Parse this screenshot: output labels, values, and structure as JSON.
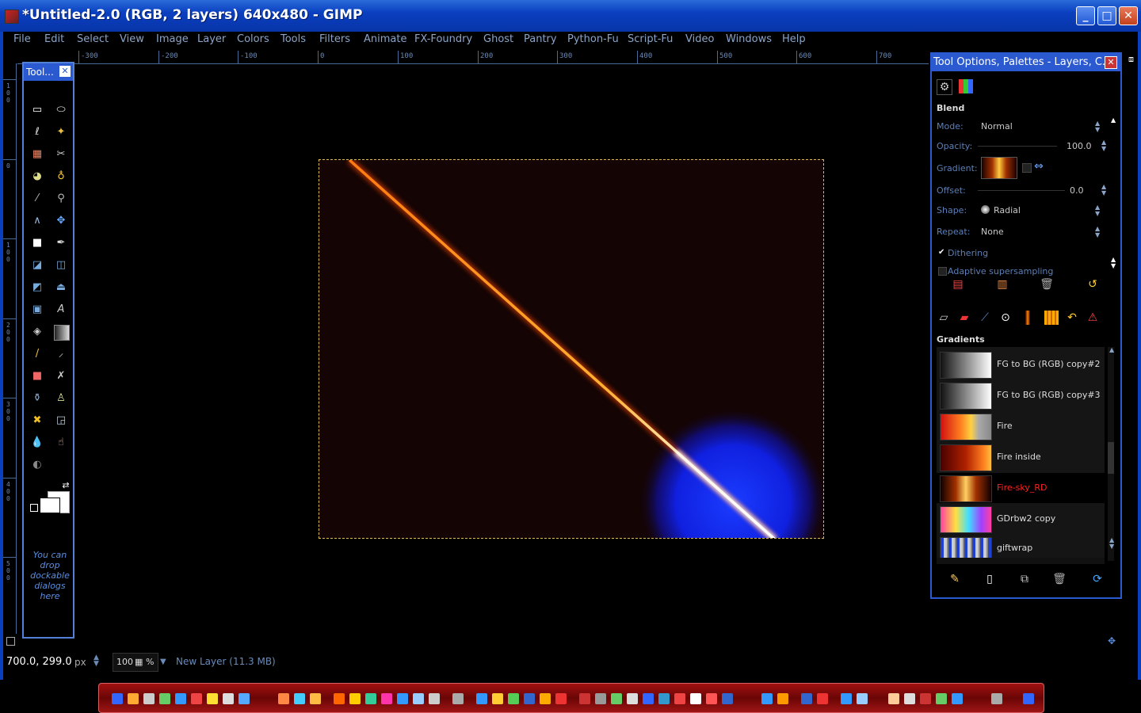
{
  "window": {
    "title": "*Untitled-2.0 (RGB, 2 layers) 640x480 - GIMP",
    "minimize": "_",
    "maximize": "□",
    "close": "✕"
  },
  "menu": [
    "File",
    "Edit",
    "Select",
    "View",
    "Image",
    "Layer",
    "Colors",
    "Tools",
    "Filters",
    "Animate",
    "FX-Foundry",
    "Ghost",
    "Pantry",
    "Python-Fu",
    "Script-Fu",
    "Video",
    "Windows",
    "Help"
  ],
  "ruler": {
    "h_labels": [
      "-300",
      "-200",
      "-100",
      "0",
      "100",
      "200",
      "300",
      "400",
      "500",
      "600",
      "700"
    ],
    "v_labels": [
      "100",
      "0",
      "100",
      "200",
      "300",
      "400",
      "500"
    ]
  },
  "toolbox": {
    "title": "Tool...",
    "hint": "You can drop dockable dialogs here"
  },
  "dock": {
    "title": "Tool Options, Palettes - Layers, C...",
    "section": "Blend",
    "mode_label": "Mode:",
    "mode_value": "Normal",
    "opacity_label": "Opacity:",
    "opacity_value": "100.0",
    "gradient_label": "Gradient:",
    "offset_label": "Offset:",
    "offset_value": "0.0",
    "shape_label": "Shape:",
    "shape_value": "Radial",
    "repeat_label": "Repeat:",
    "repeat_value": "None",
    "dithering": "Dithering",
    "supersampling": "Adaptive supersampling",
    "gradients_title": "Gradients",
    "gradients": [
      {
        "name": "FG to BG (RGB) copy#2",
        "selected": false
      },
      {
        "name": "FG to BG (RGB) copy#3",
        "selected": false
      },
      {
        "name": "Fire",
        "selected": false
      },
      {
        "name": "Fire inside",
        "selected": false
      },
      {
        "name": "Fire-sky_RD",
        "selected": true
      },
      {
        "name": "GDrbw2 copy",
        "selected": false
      },
      {
        "name": "giftwrap",
        "selected": false
      }
    ]
  },
  "status": {
    "coords": "700.0, 299.0",
    "unit": "px",
    "zoom": "100",
    "zoom_suffix": "%",
    "layer_info": "New Layer (11.3 MB)"
  },
  "colors": {
    "accent": "#2b5ad0",
    "selected_gradient": "#ff2020",
    "label": "#5b7fb8"
  }
}
